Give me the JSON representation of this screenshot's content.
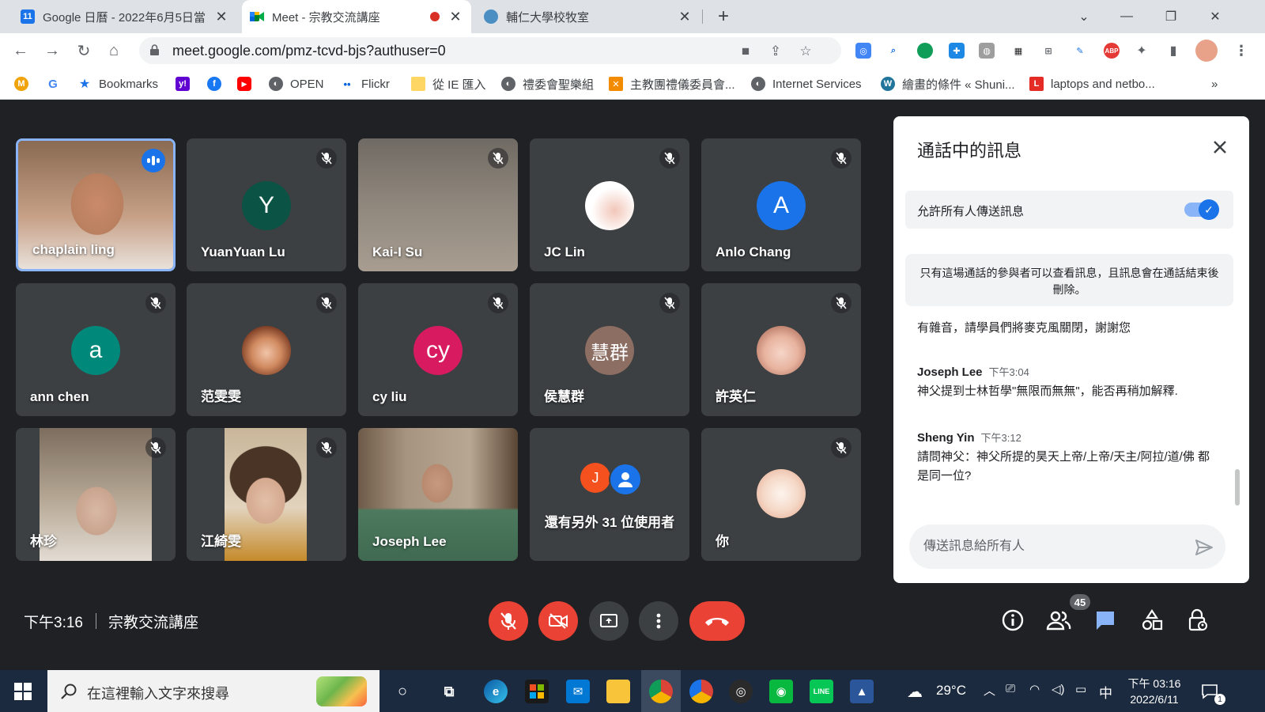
{
  "browser": {
    "tabs": [
      {
        "title": "Google 日曆 - 2022年6月5日當",
        "favicon_text": "11",
        "favicon_color": "#1a73e8"
      },
      {
        "title": "Meet - 宗教交流講座",
        "favicon_color": "#00832d"
      },
      {
        "title": "輔仁大學校牧室",
        "favicon_color": "#4a8ec2"
      }
    ],
    "new_tab": "+",
    "url": "meet.google.com/pmz-tcvd-bjs?authuser=0",
    "bookmarks": [
      {
        "label": "",
        "color": "#f0a30a",
        "glyph": "M"
      },
      {
        "label": "",
        "color": "#ffffff",
        "glyph": "G"
      },
      {
        "label": "Bookmarks",
        "color": "#1a73e8",
        "glyph": "★"
      },
      {
        "label": "",
        "color": "#6001d2",
        "glyph": "y!"
      },
      {
        "label": "",
        "color": "#1877f2",
        "glyph": "f"
      },
      {
        "label": "",
        "color": "#ff0000",
        "glyph": "▶"
      },
      {
        "label": "OPEN",
        "color": "#5f6368",
        "glyph": "◐"
      },
      {
        "label": "Flickr",
        "color": "#ffffff",
        "glyph": "••"
      },
      {
        "label": "從 IE 匯入",
        "color": "#fdd663",
        "glyph": ""
      },
      {
        "label": "禮委會聖樂組",
        "color": "#5f6368",
        "glyph": "◐"
      },
      {
        "label": "主教團禮儀委員會...",
        "color": "#f28b00",
        "glyph": "✕"
      },
      {
        "label": "Internet Services",
        "color": "#5f6368",
        "glyph": "◐"
      },
      {
        "label": "繪畫的條件 « Shuni...",
        "color": "#21759b",
        "glyph": "W"
      },
      {
        "label": "laptops and netbo...",
        "color": "#e42b26",
        "glyph": "L"
      }
    ],
    "more_bookmarks": "»"
  },
  "meet": {
    "tiles": [
      {
        "name": "chaplain ling",
        "type": "video",
        "speaking": true
      },
      {
        "name": "YuanYuan Lu",
        "type": "avatar",
        "initial": "Y",
        "color": "#0b5345",
        "muted": true
      },
      {
        "name": "Kai-I Su",
        "type": "video",
        "muted": true
      },
      {
        "name": "JC Lin",
        "type": "photo",
        "muted": true
      },
      {
        "name": "Anlo Chang",
        "type": "avatar",
        "initial": "A",
        "color": "#1a73e8",
        "muted": true
      },
      {
        "name": "ann chen",
        "type": "avatar",
        "initial": "a",
        "color": "#00897b",
        "muted": true
      },
      {
        "name": "范雯雯",
        "type": "photo",
        "muted": true
      },
      {
        "name": "cy liu",
        "type": "avatar",
        "initial": "cy",
        "color": "#d81b60",
        "muted": true
      },
      {
        "name": "侯慧群",
        "type": "avatar",
        "initial": "慧群",
        "color": "#8d6e63",
        "muted": true
      },
      {
        "name": "許英仁",
        "type": "photo",
        "muted": true
      },
      {
        "name": "林珍",
        "type": "video",
        "muted": true
      },
      {
        "name": "江綺雯",
        "type": "video",
        "muted": true
      },
      {
        "name": "Joseph Lee",
        "type": "video",
        "muted": false
      },
      {
        "name": "還有另外 31 位使用者",
        "type": "others",
        "initial": "J"
      },
      {
        "name": "你",
        "type": "photo",
        "muted": true
      }
    ],
    "time": "下午3:16",
    "meeting_name": "宗教交流講座",
    "participant_count": "45"
  },
  "chat": {
    "title": "通話中的訊息",
    "allow_label": "允許所有人傳送訊息",
    "allow_enabled": true,
    "notice": "只有這場通話的參與者可以查看訊息，且訊息會在通話結束後刪除。",
    "messages": [
      {
        "sender": "",
        "time": "",
        "text": "有雜音，請學員們將麥克風關閉，謝謝您"
      },
      {
        "sender": "Joseph Lee",
        "time": "下午3:04",
        "text": "神父提到士林哲學\"無限而無無\"，能否再稍加解釋."
      },
      {
        "sender": "Sheng Yin",
        "time": "下午3:12",
        "text": "請問神父：神父所提的昊天上帝/上帝/天主/阿拉/道/佛 都是同一位?"
      }
    ],
    "input_placeholder": "傳送訊息給所有人"
  },
  "taskbar": {
    "search_placeholder": "在這裡輸入文字來搜尋",
    "weather": "29°C",
    "ime": "中",
    "clock_time": "下午 03:16",
    "clock_date": "2022/6/11",
    "notification_count": "1"
  }
}
